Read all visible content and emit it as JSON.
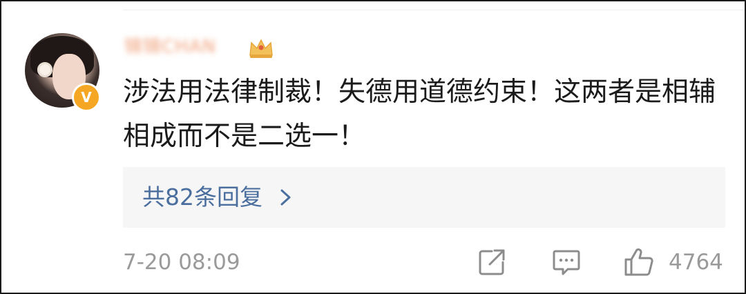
{
  "comment": {
    "username": "锦锦CHAN",
    "text": "涉法用法律制裁！失德用道德约束！这两者是相辅相成而不是二选一！",
    "replies_label": "共82条回复",
    "timestamp": "7-20 08:09",
    "like_count": "4764",
    "verified_badge": "V"
  },
  "icons": {
    "crown": "crown-icon",
    "verified": "verified-badge",
    "chevron": "chevron-right-icon",
    "share": "share-icon",
    "comment": "comment-icon",
    "like": "thumbs-up-icon"
  },
  "colors": {
    "username": "#f0a07a",
    "link": "#4a6e9e",
    "meta": "#9a9a9a",
    "badge": "#f5a623",
    "reply_bg": "#f6f6f6"
  }
}
